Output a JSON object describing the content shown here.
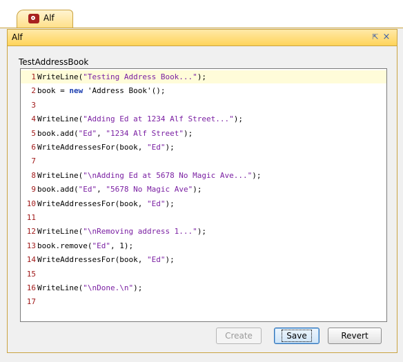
{
  "tab": {
    "label": "Alf"
  },
  "panel": {
    "title": "Alf",
    "restore_glyph": "⇱",
    "close_glyph": "×",
    "file_name": "TestAddressBook"
  },
  "editor": {
    "current_line": 1,
    "lines": [
      {
        "n": "1",
        "parts": [
          [
            "c",
            "WriteLine("
          ],
          [
            "s",
            "\"Testing Address Book...\""
          ],
          [
            "c",
            ");"
          ]
        ]
      },
      {
        "n": "2",
        "parts": [
          [
            "c",
            "book = "
          ],
          [
            "k",
            "new"
          ],
          [
            "c",
            " 'Address Book'();"
          ]
        ]
      },
      {
        "n": "3",
        "parts": []
      },
      {
        "n": "4",
        "parts": [
          [
            "c",
            "WriteLine("
          ],
          [
            "s",
            "\"Adding Ed at 1234 Alf Street...\""
          ],
          [
            "c",
            ");"
          ]
        ]
      },
      {
        "n": "5",
        "parts": [
          [
            "c",
            "book.add("
          ],
          [
            "s",
            "\"Ed\""
          ],
          [
            "c",
            ", "
          ],
          [
            "s",
            "\"1234 Alf Street\""
          ],
          [
            "c",
            ");"
          ]
        ]
      },
      {
        "n": "6",
        "parts": [
          [
            "c",
            "WriteAddressesFor(book, "
          ],
          [
            "s",
            "\"Ed\""
          ],
          [
            "c",
            ");"
          ]
        ]
      },
      {
        "n": "7",
        "parts": []
      },
      {
        "n": "8",
        "parts": [
          [
            "c",
            "WriteLine("
          ],
          [
            "s",
            "\"\\nAdding Ed at 5678 No Magic Ave...\""
          ],
          [
            "c",
            ");"
          ]
        ]
      },
      {
        "n": "9",
        "parts": [
          [
            "c",
            "book.add("
          ],
          [
            "s",
            "\"Ed\""
          ],
          [
            "c",
            ", "
          ],
          [
            "s",
            "\"5678 No Magic Ave\""
          ],
          [
            "c",
            ");"
          ]
        ]
      },
      {
        "n": "10",
        "parts": [
          [
            "c",
            "WriteAddressesFor(book, "
          ],
          [
            "s",
            "\"Ed\""
          ],
          [
            "c",
            ");"
          ]
        ]
      },
      {
        "n": "11",
        "parts": []
      },
      {
        "n": "12",
        "parts": [
          [
            "c",
            "WriteLine("
          ],
          [
            "s",
            "\"\\nRemoving address 1...\""
          ],
          [
            "c",
            ");"
          ]
        ]
      },
      {
        "n": "13",
        "parts": [
          [
            "c",
            "book.remove("
          ],
          [
            "s",
            "\"Ed\""
          ],
          [
            "c",
            ", 1);"
          ]
        ]
      },
      {
        "n": "14",
        "parts": [
          [
            "c",
            "WriteAddressesFor(book, "
          ],
          [
            "s",
            "\"Ed\""
          ],
          [
            "c",
            ");"
          ]
        ]
      },
      {
        "n": "15",
        "parts": []
      },
      {
        "n": "16",
        "parts": [
          [
            "c",
            "WriteLine("
          ],
          [
            "s",
            "\"\\nDone.\\n\""
          ],
          [
            "c",
            ");"
          ]
        ]
      },
      {
        "n": "17",
        "parts": []
      }
    ]
  },
  "buttons": {
    "create": "Create",
    "save": "Save",
    "revert": "Revert"
  },
  "colors": {
    "panel_header": "#ffd45a",
    "status_marker": "#22b322",
    "string": "#7a1fa2",
    "keyword": "#1d3fb0",
    "line_number": "#a11a1a"
  }
}
